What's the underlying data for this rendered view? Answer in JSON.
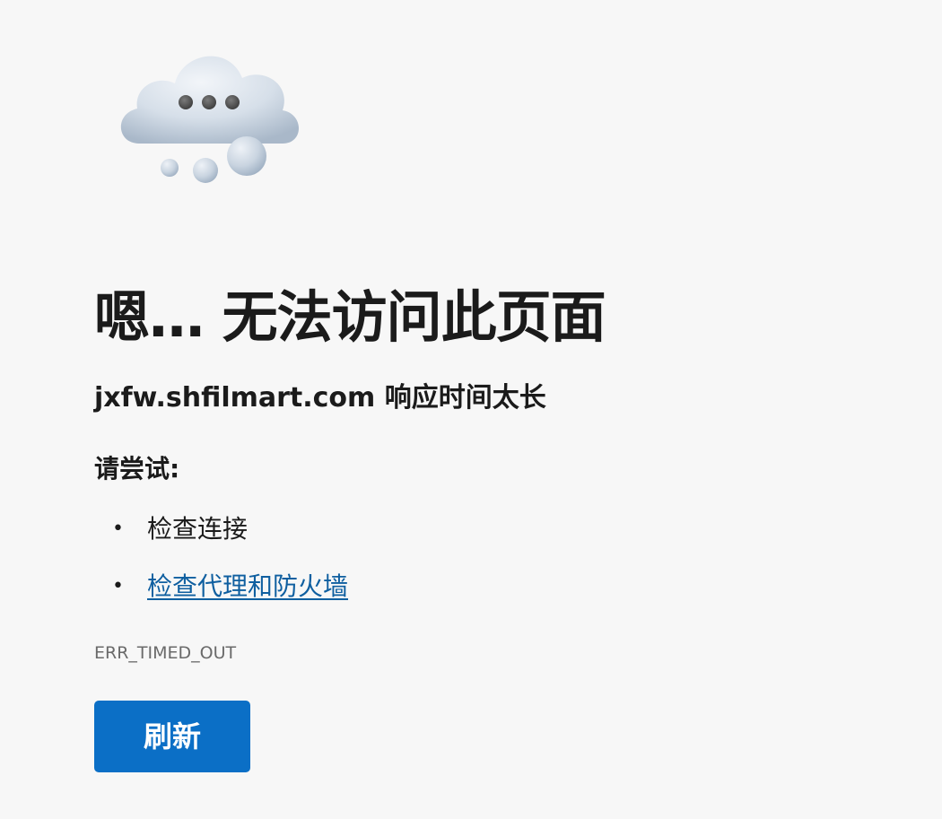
{
  "error_page": {
    "icon": "thinking-cloud-icon",
    "title": "嗯… 无法访问此页面",
    "subtitle": "jxfw.shfilmart.com 响应时间太长",
    "try_label": "请尝试:",
    "suggestions": [
      {
        "text": "检查连接",
        "is_link": false
      },
      {
        "text": "检查代理和防火墙",
        "is_link": true
      }
    ],
    "error_code": "ERR_TIMED_OUT",
    "refresh_button": "刷新"
  },
  "colors": {
    "background": "#f7f7f7",
    "text": "#1b1b1b",
    "link": "#0f5fa0",
    "button": "#0b6fc6",
    "error_code": "#6a6a6a"
  }
}
